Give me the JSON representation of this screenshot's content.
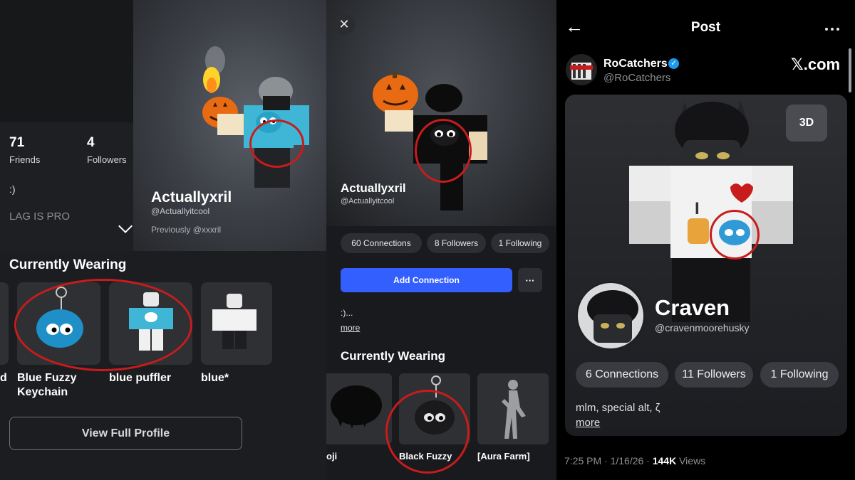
{
  "left_panel": {
    "stats": {
      "friends_count": "71",
      "friends_label": "Friends",
      "followers_count": "4",
      "followers_label": "Followers"
    },
    "bio_line1": ":)",
    "bio_line2": "LAG IS PRO",
    "profile": {
      "display_name": "Actuallyxril",
      "username": "@Actuallyitcool",
      "previously": "Previously @xxxril"
    },
    "section_title": "Currently Wearing",
    "items": [
      {
        "label": "d"
      },
      {
        "label": "Blue Fuzzy\nKeychain"
      },
      {
        "label": "blue puffler"
      },
      {
        "label": "blue*"
      }
    ],
    "view_full_profile_label": "View Full Profile"
  },
  "middle_panel": {
    "close_icon": "close-icon",
    "profile": {
      "display_name": "Actuallyxril",
      "username": "@Actuallyitcool"
    },
    "pills": [
      "60 Connections",
      "8 Followers",
      "1 Following"
    ],
    "add_connection_label": "Add Connection",
    "more_dots": "···",
    "bio": ":)...",
    "more_link": "more",
    "section_title": "Currently Wearing",
    "items": [
      {
        "label": "oji"
      },
      {
        "label": "Black Fuzzy"
      },
      {
        "label": "[Aura Farm]"
      }
    ]
  },
  "right_panel": {
    "header_title": "Post",
    "author": {
      "name": "RoCatchers",
      "handle": "@RoCatchers",
      "verified": true
    },
    "site_mark": "𝕏.com",
    "badge_3d": "3D",
    "profile": {
      "display_name": "Craven",
      "username": "@cravenmoorehusky"
    },
    "pills": [
      "6 Connections",
      "11 Followers",
      "1 Following"
    ],
    "bio": "mlm, special alt, ζ",
    "more_link": "more",
    "meta": {
      "time": "7:25 PM · 1/16/26 · ",
      "views_count": "144K",
      "views_label": " Views"
    }
  },
  "colors": {
    "accent_blue": "#335fff",
    "highlight_red": "#c81c1c",
    "verified_blue": "#1d9bf0"
  }
}
